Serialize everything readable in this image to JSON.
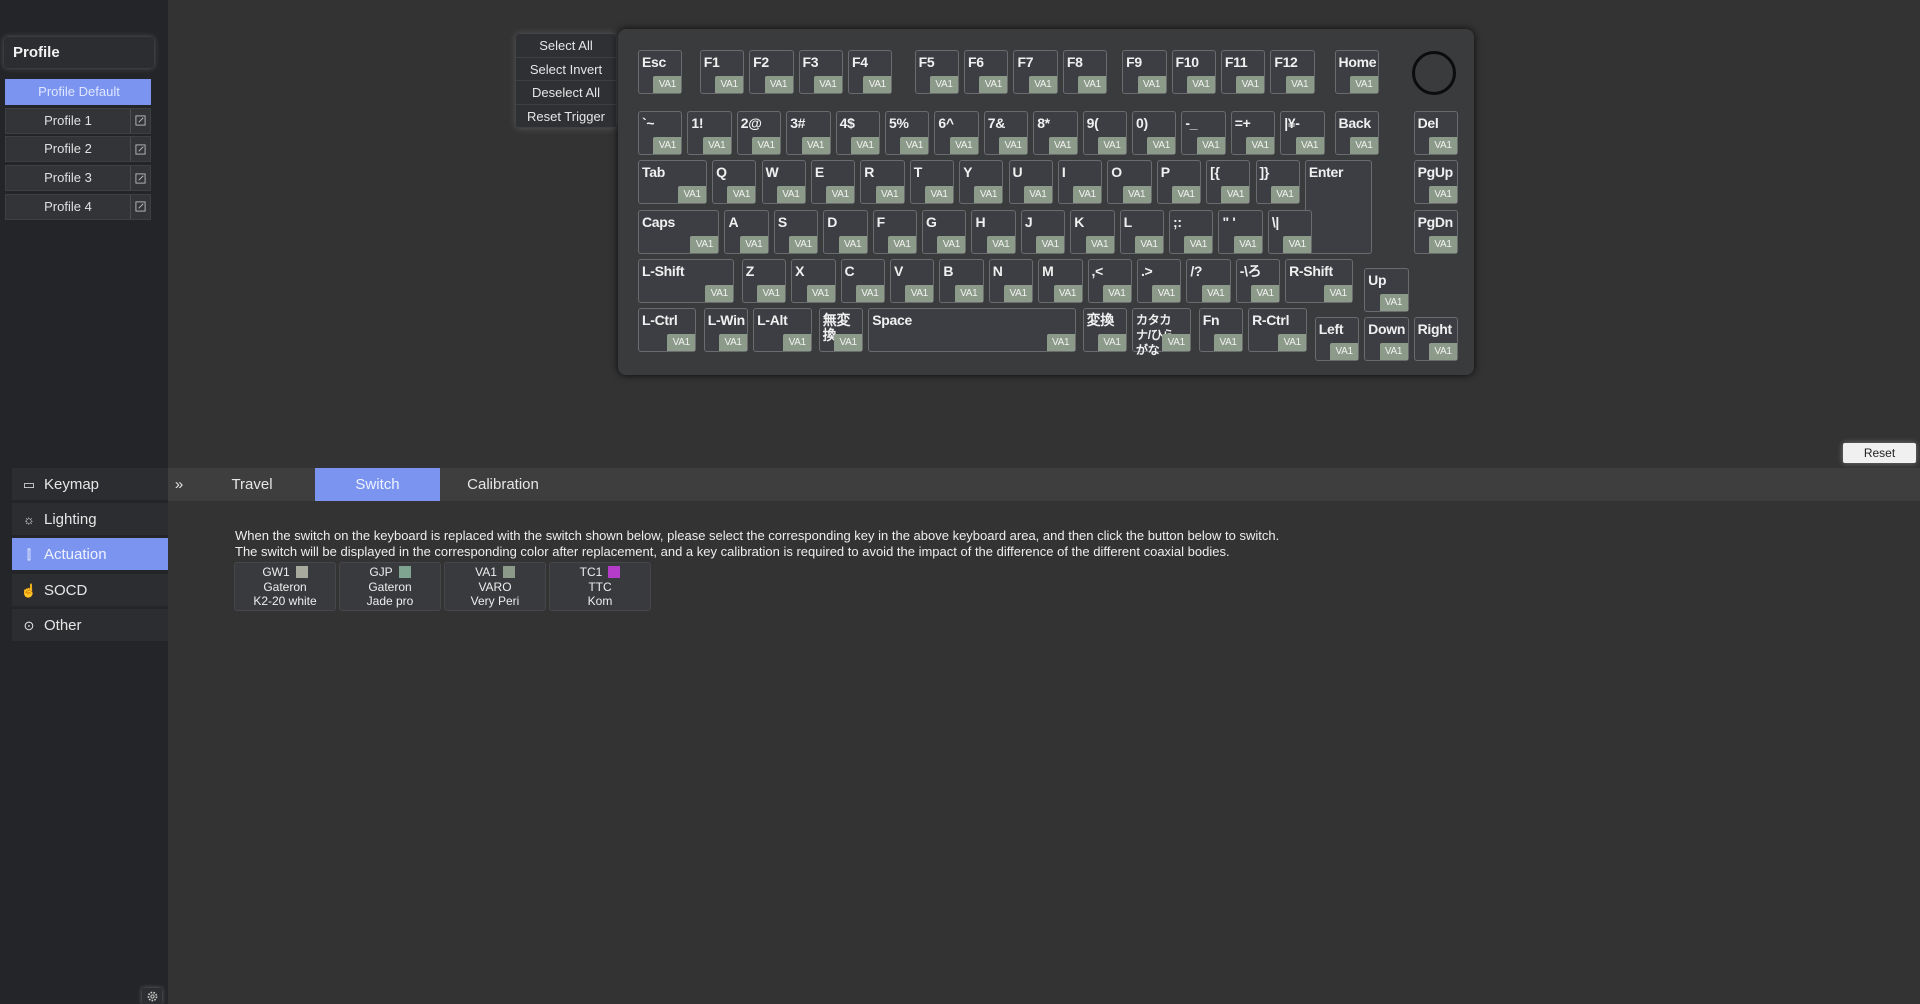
{
  "sidebar": {
    "profile_title": "Profile",
    "profiles": [
      "Profile Default",
      "Profile 1",
      "Profile 2",
      "Profile 3",
      "Profile 4"
    ],
    "nav": [
      {
        "label": "Keymap",
        "icon": "keyboard-icon"
      },
      {
        "label": "Lighting",
        "icon": "bulb-icon"
      },
      {
        "label": "Actuation",
        "icon": "actuation-icon"
      },
      {
        "label": "SOCD",
        "icon": "hand-pointer-icon"
      },
      {
        "label": "Other",
        "icon": "more-icon"
      }
    ]
  },
  "menu": [
    "Select All",
    "Select Invert",
    "Deselect All",
    "Reset Trigger"
  ],
  "keyboard": {
    "badge": "VA1",
    "badge_color": "#8c9a89",
    "rows": [
      [
        "Esc",
        "F1",
        "F2",
        "F3",
        "F4",
        "F5",
        "F6",
        "F7",
        "F8",
        "F9",
        "F10",
        "F11",
        "F12",
        "Home"
      ],
      [
        "`~",
        "1!",
        "2@",
        "3#",
        "4$",
        "5%",
        "6^",
        "7&",
        "8*",
        "9(",
        "0)",
        "-_",
        "=+",
        "|¥-",
        "Back",
        "Del"
      ],
      [
        "Tab",
        "Q",
        "W",
        "E",
        "R",
        "T",
        "Y",
        "U",
        "I",
        "O",
        "P",
        "[{",
        "]}",
        "Enter",
        "PgUp"
      ],
      [
        "Caps",
        "A",
        "S",
        "D",
        "F",
        "G",
        "H",
        "J",
        "K",
        "L",
        ";:",
        "\" '",
        "\\|",
        "PgDn"
      ],
      [
        "L-Shift",
        "Z",
        "X",
        "C",
        "V",
        "B",
        "N",
        "M",
        ",<",
        ".>",
        "/?",
        "-\\ろ",
        "R-Shift",
        "Up"
      ],
      [
        "L-Ctrl",
        "L-Win",
        "L-Alt",
        "無変換",
        "Space",
        "変換",
        "カタカナ/ひらがな",
        "Fn",
        "R-Ctrl",
        "Left",
        "Down",
        "Right"
      ]
    ]
  },
  "reset_label": "Reset",
  "tabs": [
    "Travel",
    "Switch",
    "Calibration"
  ],
  "description": [
    "When the switch on the keyboard is replaced with the switch shown below, please select the corresponding key in the above keyboard area, and then click the button below to switch.",
    "The switch will be displayed in the corresponding color after replacement, and a key calibration is required to avoid the impact of the difference of the different coaxial bodies."
  ],
  "switches": [
    {
      "code": "GW1",
      "color": "#a9aa9e",
      "brand": "Gateron",
      "model": "K2-20 white"
    },
    {
      "code": "GJP",
      "color": "#7fa48f",
      "brand": "Gateron",
      "model": "Jade pro"
    },
    {
      "code": "VA1",
      "color": "#8c9a89",
      "brand": "VARO",
      "model": "Very Peri"
    },
    {
      "code": "TC1",
      "color": "#b43cc8",
      "brand": "TTC",
      "model": "Kom"
    }
  ]
}
